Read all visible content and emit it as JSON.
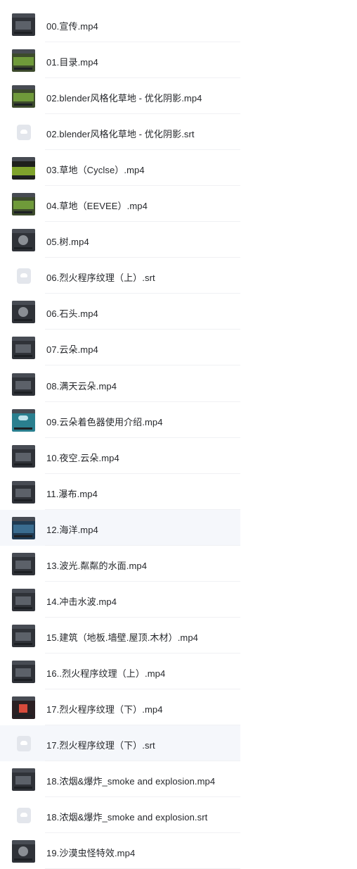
{
  "files": [
    {
      "name": "00.宣传.mp4",
      "type": "video",
      "thumb": "dark"
    },
    {
      "name": "01.目录.mp4",
      "type": "video",
      "thumb": "grass"
    },
    {
      "name": "02.blender风格化草地 - 优化阴影.mp4",
      "type": "video",
      "thumb": "grass"
    },
    {
      "name": "02.blender风格化草地 - 优化阴影.srt",
      "type": "subtitle",
      "thumb": "subtitle-icon"
    },
    {
      "name": "03.草地（Cyclse）.mp4",
      "type": "video",
      "thumb": "field"
    },
    {
      "name": "04.草地（EEVEE）.mp4",
      "type": "video",
      "thumb": "grass"
    },
    {
      "name": "05.树.mp4",
      "type": "video",
      "thumb": "sphere"
    },
    {
      "name": "06.烈火程序纹理（上）.srt",
      "type": "subtitle",
      "thumb": "subtitle-icon"
    },
    {
      "name": "06.石头.mp4",
      "type": "video",
      "thumb": "sphere"
    },
    {
      "name": "07.云朵.mp4",
      "type": "video",
      "thumb": "dark"
    },
    {
      "name": "08.满天云朵.mp4",
      "type": "video",
      "thumb": "dark"
    },
    {
      "name": "09.云朵着色器使用介绍.mp4",
      "type": "video",
      "thumb": "sky"
    },
    {
      "name": "10.夜空.云朵.mp4",
      "type": "video",
      "thumb": "dark"
    },
    {
      "name": "11.瀑布.mp4",
      "type": "video",
      "thumb": "dark"
    },
    {
      "name": "12.海洋.mp4",
      "type": "video",
      "thumb": "ocean",
      "highlighted": true
    },
    {
      "name": "13.波光.粼粼的水面.mp4",
      "type": "video",
      "thumb": "dark"
    },
    {
      "name": "14.冲击水波.mp4",
      "type": "video",
      "thumb": "dark"
    },
    {
      "name": "15.建筑（地板.墙壁.屋顶.木材）.mp4",
      "type": "video",
      "thumb": "dark"
    },
    {
      "name": "16..烈火程序纹理（上）.mp4",
      "type": "video",
      "thumb": "dark"
    },
    {
      "name": "17.烈火程序纹理（下）.mp4",
      "type": "video",
      "thumb": "fire"
    },
    {
      "name": "17.烈火程序纹理（下）.srt",
      "type": "subtitle",
      "thumb": "subtitle-icon",
      "highlighted": true
    },
    {
      "name": "18.浓烟&爆炸_smoke and explosion.mp4",
      "type": "video",
      "thumb": "dark"
    },
    {
      "name": "18.浓烟&爆炸_smoke and explosion.srt",
      "type": "subtitle",
      "thumb": "subtitle-icon"
    },
    {
      "name": "19.沙漠虫怪特效.mp4",
      "type": "video",
      "thumb": "sphere"
    }
  ]
}
